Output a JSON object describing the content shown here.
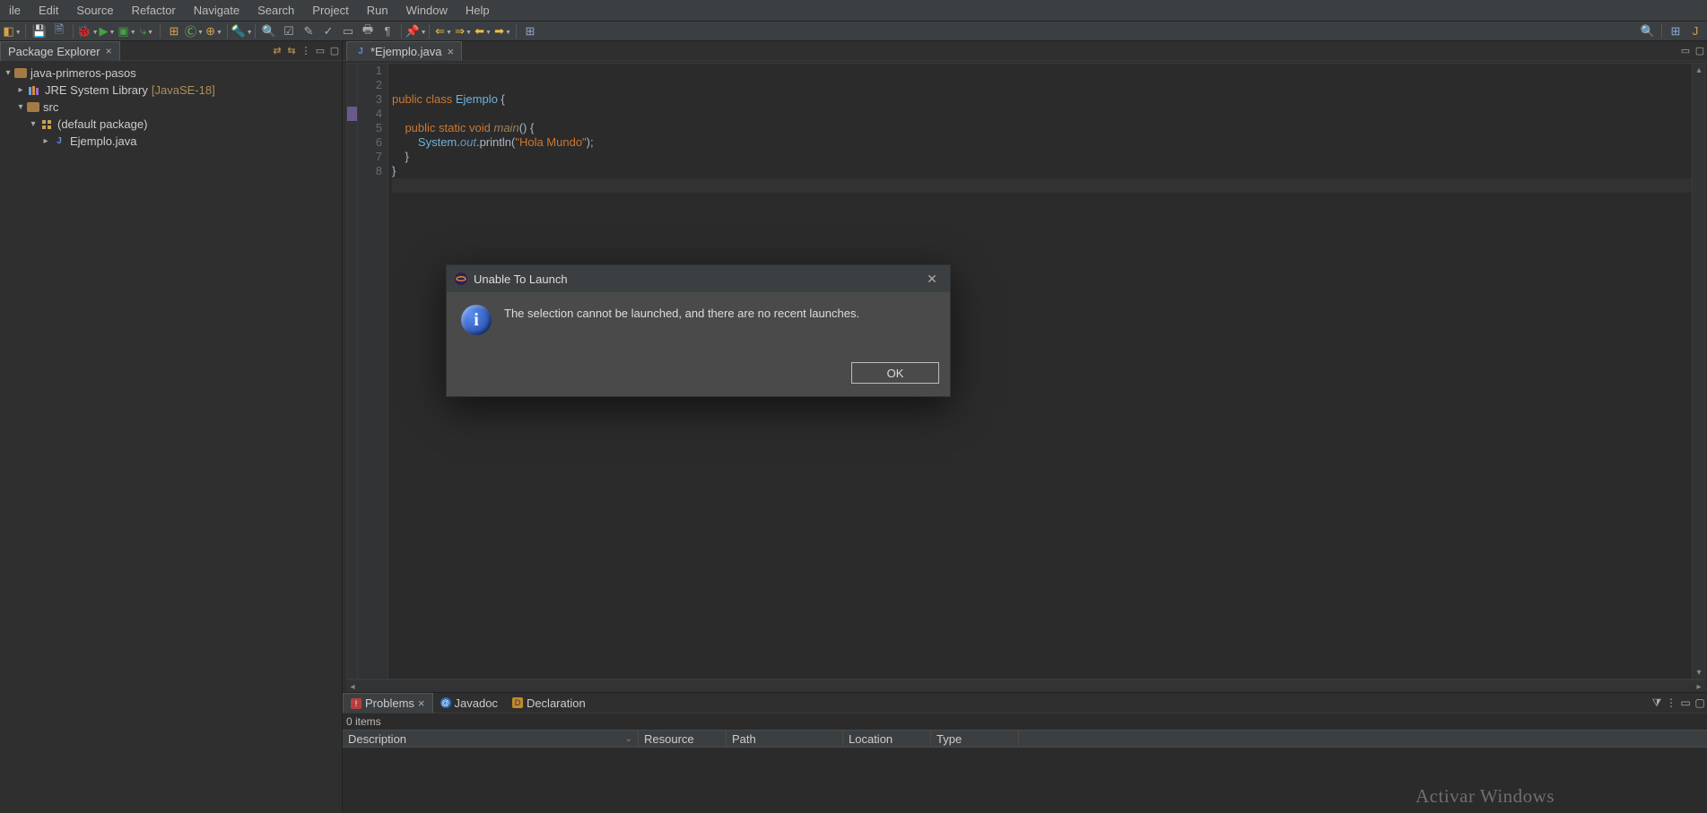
{
  "menubar": [
    "ile",
    "Edit",
    "Source",
    "Refactor",
    "Navigate",
    "Search",
    "Project",
    "Run",
    "Window",
    "Help"
  ],
  "sidebar": {
    "tab": "Package Explorer",
    "tree": {
      "project": "java-primeros-pasos",
      "jre": {
        "label": "JRE System Library",
        "suffix": "[JavaSE-18]"
      },
      "src": "src",
      "pkg": "(default package)",
      "file": "Ejemplo.java"
    }
  },
  "editor": {
    "tab": "*Ejemplo.java",
    "lines": [
      "1",
      "2",
      "3",
      "4",
      "5",
      "6",
      "7",
      "8"
    ],
    "code": {
      "l2": {
        "kw1": "public",
        "kw2": "class",
        "cls": "Ejemplo",
        "rest": " {"
      },
      "l4": {
        "kw1": "public",
        "kw2": "static",
        "kw3": "void",
        "fn": "main",
        "rest": "() {"
      },
      "l5": {
        "sys": "System",
        "out": "out",
        "pr": "println",
        "str": "\"Hola Mundo\"",
        "end": ";"
      },
      "l6": "    }",
      "l7": "}"
    }
  },
  "bottom": {
    "tabs": {
      "problems": "Problems",
      "javadoc": "Javadoc",
      "declaration": "Declaration"
    },
    "count": "0 items",
    "columns": {
      "desc": "Description",
      "res": "Resource",
      "path": "Path",
      "loc": "Location",
      "type": "Type"
    }
  },
  "dialog": {
    "title": "Unable To Launch",
    "message": "The selection cannot be launched, and there are no recent launches.",
    "ok": "OK"
  },
  "watermark": "Activar Windows"
}
